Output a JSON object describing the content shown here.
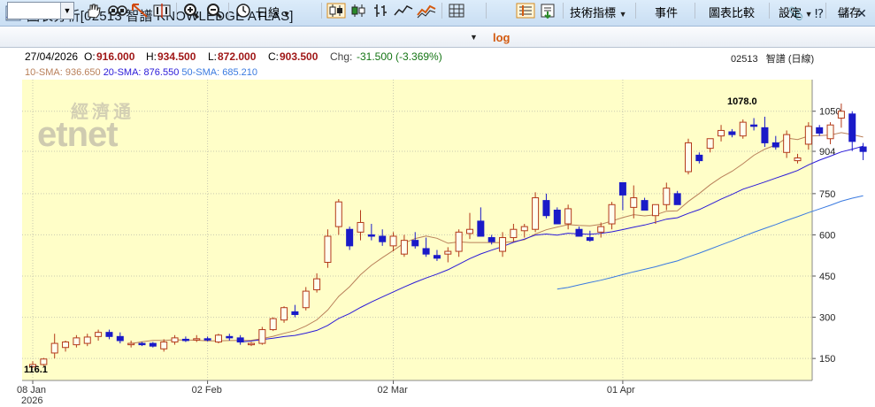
{
  "window": {
    "title": "圖表分析[02513 智譜 KNOWLEDGE ATLAS]",
    "buttons": [
      "attach-icon",
      "help-icon",
      "minimize-icon",
      "close-icon"
    ]
  },
  "toolbar": {
    "symbol_value": "",
    "period_label": "日線",
    "log_label": "log",
    "indicators_label": "技術指標",
    "events_label": "事件",
    "compare_label": "圖表比較",
    "settings_label": "設定",
    "save_label": "儲存"
  },
  "info": {
    "date": "27/04/2026",
    "open_label": "O:",
    "open": "916.000",
    "high_label": "H:",
    "high": "934.500",
    "low_label": "L:",
    "low": "872.000",
    "close_label": "C:",
    "close": "903.500",
    "chg_label": "Chg:",
    "chg": "-31.500 (-3.369%)",
    "stock": "02513",
    "stock_name": "智譜 (日線)"
  },
  "sma": {
    "sma10_label": "10-SMA:",
    "sma10": "936.650",
    "sma10_color": "#b9805a",
    "sma20_label": "20-SMA:",
    "sma20": "876.550",
    "sma20_color": "#2a1ad8",
    "sma50_label": "50-SMA:",
    "sma50": "685.210",
    "sma50_color": "#3a7ae0"
  },
  "watermark": {
    "cn": "經濟通",
    "en": "etnet"
  },
  "colors": {
    "up": "#b33a1a",
    "down": "#1a1ac8",
    "chart_bg": "#fffec8"
  },
  "chart_data": {
    "type": "candlestick",
    "ylim": [
      70,
      1165
    ],
    "y_ticks": [
      150,
      300,
      450,
      600,
      750,
      904,
      1050
    ],
    "y_tick_labels": [
      "150",
      "300",
      "450",
      "600",
      "750",
      "904",
      "1050"
    ],
    "x_tick_labels": [
      "08 Jan",
      "02 Feb",
      "02 Mar",
      "01 Apr"
    ],
    "x_tick_index": [
      0,
      16,
      33,
      54
    ],
    "year_label": "2026",
    "low_annotation": "116.1",
    "high_annotation": "1078.0",
    "candles": [
      [
        120,
        140,
        116.1,
        128
      ],
      [
        128,
        152,
        122,
        148
      ],
      [
        170,
        240,
        150,
        205
      ],
      [
        190,
        215,
        175,
        210
      ],
      [
        200,
        235,
        190,
        225
      ],
      [
        205,
        240,
        195,
        228
      ],
      [
        230,
        255,
        215,
        245
      ],
      [
        245,
        255,
        220,
        230
      ],
      [
        230,
        245,
        205,
        215
      ],
      [
        200,
        215,
        190,
        205
      ],
      [
        205,
        210,
        195,
        200
      ],
      [
        205,
        210,
        190,
        195
      ],
      [
        185,
        220,
        175,
        210
      ],
      [
        210,
        235,
        200,
        225
      ],
      [
        220,
        230,
        210,
        218
      ],
      [
        218,
        235,
        210,
        222
      ],
      [
        222,
        230,
        212,
        218
      ],
      [
        210,
        240,
        205,
        235
      ],
      [
        230,
        240,
        215,
        225
      ],
      [
        225,
        235,
        200,
        210
      ],
      [
        200,
        210,
        195,
        205
      ],
      [
        205,
        265,
        200,
        255
      ],
      [
        255,
        300,
        250,
        295
      ],
      [
        290,
        340,
        280,
        335
      ],
      [
        320,
        345,
        300,
        310
      ],
      [
        335,
        410,
        325,
        395
      ],
      [
        400,
        460,
        390,
        440
      ],
      [
        500,
        620,
        480,
        595
      ],
      [
        630,
        730,
        600,
        720
      ],
      [
        620,
        630,
        545,
        560
      ],
      [
        610,
        690,
        580,
        645
      ],
      [
        600,
        640,
        580,
        595
      ],
      [
        595,
        620,
        560,
        575
      ],
      [
        560,
        610,
        540,
        595
      ],
      [
        530,
        600,
        520,
        580
      ],
      [
        580,
        610,
        550,
        560
      ],
      [
        550,
        590,
        520,
        530
      ],
      [
        525,
        545,
        505,
        515
      ],
      [
        530,
        555,
        500,
        540
      ],
      [
        540,
        620,
        520,
        610
      ],
      [
        605,
        680,
        585,
        620
      ],
      [
        650,
        700,
        620,
        595
      ],
      [
        590,
        600,
        565,
        575
      ],
      [
        540,
        610,
        520,
        590
      ],
      [
        590,
        640,
        575,
        620
      ],
      [
        615,
        640,
        590,
        630
      ],
      [
        620,
        755,
        610,
        735
      ],
      [
        725,
        750,
        660,
        670
      ],
      [
        690,
        700,
        650,
        640
      ],
      [
        640,
        710,
        620,
        695
      ],
      [
        620,
        630,
        600,
        595
      ],
      [
        590,
        615,
        575,
        580
      ],
      [
        610,
        645,
        590,
        630
      ],
      [
        640,
        720,
        620,
        710
      ],
      [
        790,
        780,
        690,
        745
      ],
      [
        700,
        780,
        660,
        735
      ],
      [
        725,
        735,
        695,
        690
      ],
      [
        670,
        700,
        640,
        710
      ],
      [
        710,
        790,
        690,
        770
      ],
      [
        750,
        760,
        720,
        710
      ],
      [
        830,
        950,
        820,
        935
      ],
      [
        890,
        900,
        860,
        870
      ],
      [
        915,
        950,
        900,
        950
      ],
      [
        960,
        1000,
        940,
        980
      ],
      [
        975,
        985,
        955,
        965
      ],
      [
        960,
        1020,
        950,
        1010
      ],
      [
        1000,
        1025,
        980,
        995
      ],
      [
        990,
        1030,
        920,
        935
      ],
      [
        935,
        960,
        910,
        920
      ],
      [
        900,
        980,
        880,
        965
      ],
      [
        870,
        895,
        860,
        880
      ],
      [
        930,
        1010,
        910,
        995
      ],
      [
        990,
        1000,
        960,
        970
      ],
      [
        950,
        1010,
        930,
        1000
      ],
      [
        1025,
        1078,
        990,
        1050
      ],
      [
        1040,
        1050,
        905,
        940
      ],
      [
        920,
        934.5,
        872,
        903.5
      ]
    ]
  }
}
